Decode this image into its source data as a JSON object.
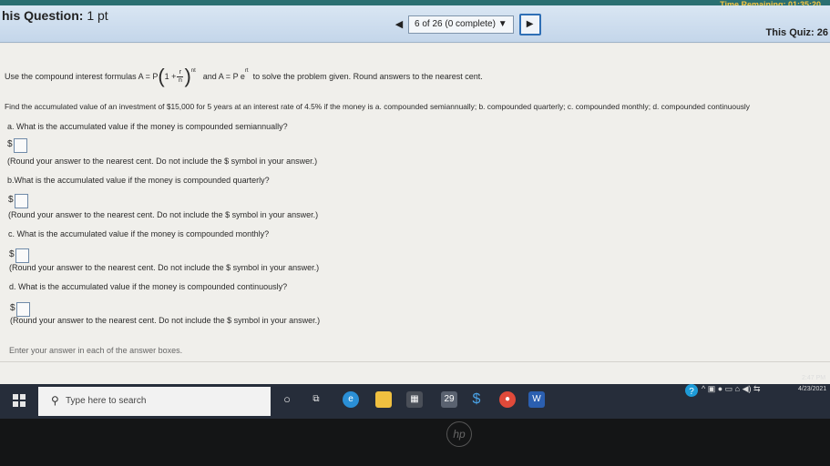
{
  "header": {
    "question_label": "his Question:",
    "question_points": "1 pt",
    "progress": "6 of 26 (0 complete)",
    "dropdown_glyph": "▼",
    "quiz_label": "This Quiz: 26",
    "timer": "Time Remaining: 01:35:20",
    "prev_glyph": "◀",
    "next_glyph": "▶"
  },
  "problem": {
    "intro_pre": "Use the compound interest formulas A = P",
    "formula_one": "1 +",
    "frac_num": "r",
    "frac_den": "n",
    "exponent_nt": "nt",
    "formula_mid": "and A = P e",
    "exponent_rt": "rt",
    "intro_post": "to solve the problem given. Round answers to the nearest cent.",
    "statement": "Find the accumulated value of an investment of $15,000 for 5 years at an interest rate of 4.5% if the money is a. compounded semiannually; b. compounded quarterly; c. compounded monthly; d. compounded continuously"
  },
  "parts": [
    {
      "question": "a. What is the accumulated value if the money is compounded semiannually?",
      "currency": "$",
      "note": "(Round your answer to the nearest cent. Do not include the $ symbol in your answer.)",
      "value": ""
    },
    {
      "question": "b.What is the accumulated value if the money is compounded quarterly?",
      "currency": "$",
      "note": "(Round your answer to the nearest cent. Do not include the $ symbol in your answer.)",
      "value": ""
    },
    {
      "question": "c. What is the accumulated value if the money is compounded monthly?",
      "currency": "$",
      "note": "(Round your answer to the nearest cent. Do not include the $ symbol in your answer.)",
      "value": ""
    },
    {
      "question": "d. What is the accumulated value if the money is compounded continuously?",
      "currency": "$",
      "note": "(Round your answer to the nearest cent. Do not include the $ symbol in your answer.)",
      "value": ""
    }
  ],
  "footer": {
    "instruction": "Enter your answer in each of the answer boxes."
  },
  "taskbar": {
    "search_placeholder": "Type here to search",
    "time": "2:47 PM",
    "date": "4/23/2021",
    "badge": "29",
    "icons": [
      "cortana-icon",
      "task-view-icon",
      "edge-icon",
      "file-explorer-icon",
      "store-icon",
      "calendar-icon",
      "app-icon",
      "chrome-icon",
      "word-icon"
    ]
  },
  "laptop": {
    "logo": "hp"
  },
  "colors": {
    "header_bg": "#c4d6ea",
    "timer": "#f4c542",
    "taskbar": "#262d3a"
  }
}
